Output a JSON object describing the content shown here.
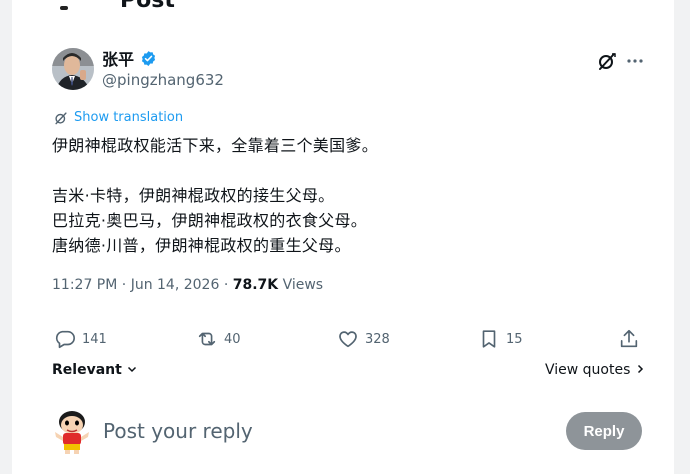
{
  "header": {
    "title": "Post"
  },
  "author": {
    "name": "张平",
    "handle": "@pingzhang632",
    "verified": true
  },
  "translate": {
    "label": "Show translation"
  },
  "tweet": {
    "lines": [
      "伊朗神棍政权能活下来，全靠着三个美国爹。",
      "",
      "吉米·卡特，伊朗神棍政权的接生父母。",
      "巴拉克·奥巴马，伊朗神棍政权的衣食父母。",
      "唐纳德·川普，伊朗神棍政权的重生父母。"
    ]
  },
  "meta": {
    "time": "11:27 PM",
    "separator1": "·",
    "date": "Jun 14, 2026",
    "separator2": "·",
    "views_count": "78.7K",
    "views_label": "Views"
  },
  "actions": {
    "replies": "141",
    "reposts": "40",
    "likes": "328",
    "bookmarks": "15"
  },
  "sort": {
    "label": "Relevant"
  },
  "quotes": {
    "label": "View quotes"
  },
  "reply": {
    "placeholder": "Post your reply",
    "button_label": "Reply"
  },
  "colors": {
    "accent": "#1d9bf0",
    "muted": "#536471",
    "text": "#0f1419"
  }
}
